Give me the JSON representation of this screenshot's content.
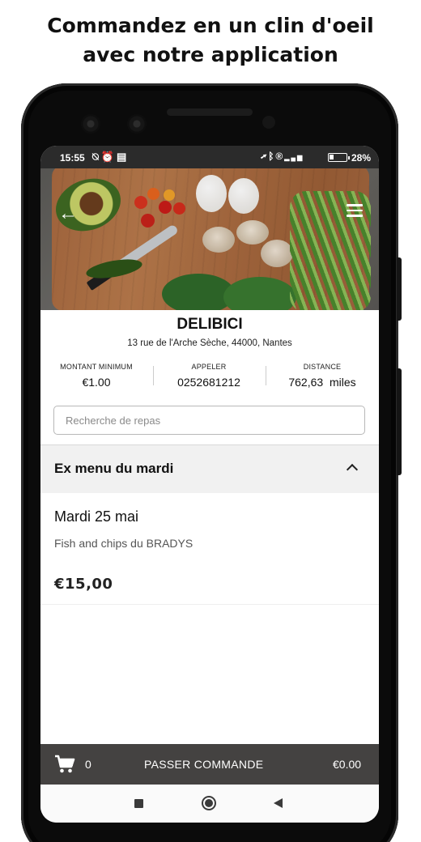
{
  "headline": {
    "line1": "Commandez en un clin d'oeil",
    "line2": "avec notre application"
  },
  "status_bar": {
    "time": "15:55",
    "left_icons": [
      "notifications-off-icon",
      "alarm-icon",
      "news-icon"
    ],
    "right_icons": [
      "location-icon",
      "bluetooth-icon",
      "registered-icon",
      "signal-4g-icon"
    ],
    "network": "4G",
    "battery_level": 0.28,
    "battery_text": "28%"
  },
  "header": {
    "back_icon": "arrow-left-icon",
    "menu_icon": "hamburger-menu-icon"
  },
  "restaurant": {
    "name": "DELIBICI",
    "address": "13 rue de l'Arche Sèche, 44000, Nantes"
  },
  "info": [
    {
      "label": "MONTANT MINIMUM",
      "value": "€1.00"
    },
    {
      "label": "APPELER",
      "value": "0252681212"
    },
    {
      "label": "DISTANCE",
      "value": "762,63  miles"
    }
  ],
  "search": {
    "placeholder": "Recherche de repas",
    "value": ""
  },
  "menu_section": {
    "title": "Ex menu du mardi",
    "expanded": true
  },
  "menu_items": [
    {
      "title": "Mardi 25 mai",
      "description": "Fish and chips du BRADYS",
      "price": "€15,00"
    }
  ],
  "cart": {
    "count": "0",
    "cta": "PASSER COMMANDE",
    "total": "€0.00"
  },
  "colors": {
    "cart_bar": "#444241",
    "status_bar": "#2b2b2b",
    "section_header": "#f1f1f1"
  }
}
